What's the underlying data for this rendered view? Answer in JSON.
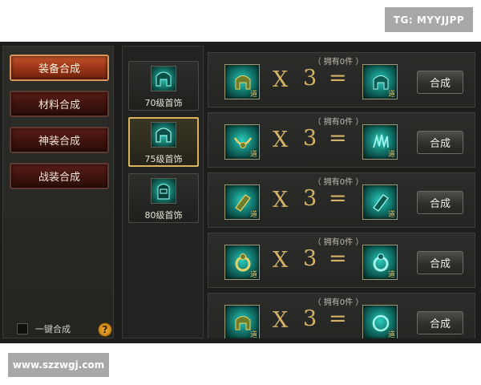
{
  "watermarks": {
    "top": "TG: MYYJJPP",
    "bottom": "www.szzwgj.com"
  },
  "categories": [
    {
      "label": "装备合成",
      "active": true
    },
    {
      "label": "材料合成",
      "active": false
    },
    {
      "label": "神装合成",
      "active": false
    },
    {
      "label": "战装合成",
      "active": false
    }
  ],
  "one_key": {
    "label": "一键合成",
    "checked": false
  },
  "help": {
    "glyph": "?"
  },
  "tiers": [
    {
      "label": "70级首饰",
      "active": false
    },
    {
      "label": "75级首饰",
      "active": true
    },
    {
      "label": "80级首饰",
      "active": false
    }
  ],
  "recipes": [
    {
      "owned": "（ 拥有0件 ）",
      "multiplier": "X",
      "count": "3",
      "equals": "=",
      "tag": "道",
      "button": "合成",
      "src_icon": "helmet-icon",
      "dst_icon": "helmet-icon"
    },
    {
      "owned": "（ 拥有0件 ）",
      "multiplier": "X",
      "count": "3",
      "equals": "=",
      "tag": "道",
      "button": "合成",
      "src_icon": "necklace-icon",
      "dst_icon": "necklace-icon"
    },
    {
      "owned": "（ 拥有0件 ）",
      "multiplier": "X",
      "count": "3",
      "equals": "=",
      "tag": "道",
      "button": "合成",
      "src_icon": "bracelet-icon",
      "dst_icon": "bracelet-icon"
    },
    {
      "owned": "（ 拥有0件 ）",
      "multiplier": "X",
      "count": "3",
      "equals": "=",
      "tag": "道",
      "button": "合成",
      "src_icon": "ring-icon",
      "dst_icon": "ring-icon"
    },
    {
      "owned": "（ 拥有0件 ）",
      "multiplier": "X",
      "count": "3",
      "equals": "=",
      "tag": "道",
      "button": "合成",
      "src_icon": "helmet-icon",
      "dst_icon": "ring-icon"
    }
  ],
  "colors": {
    "accent_gold": "#d4b267",
    "active_tab": "#9a3417",
    "item_teal": "#12786e"
  }
}
